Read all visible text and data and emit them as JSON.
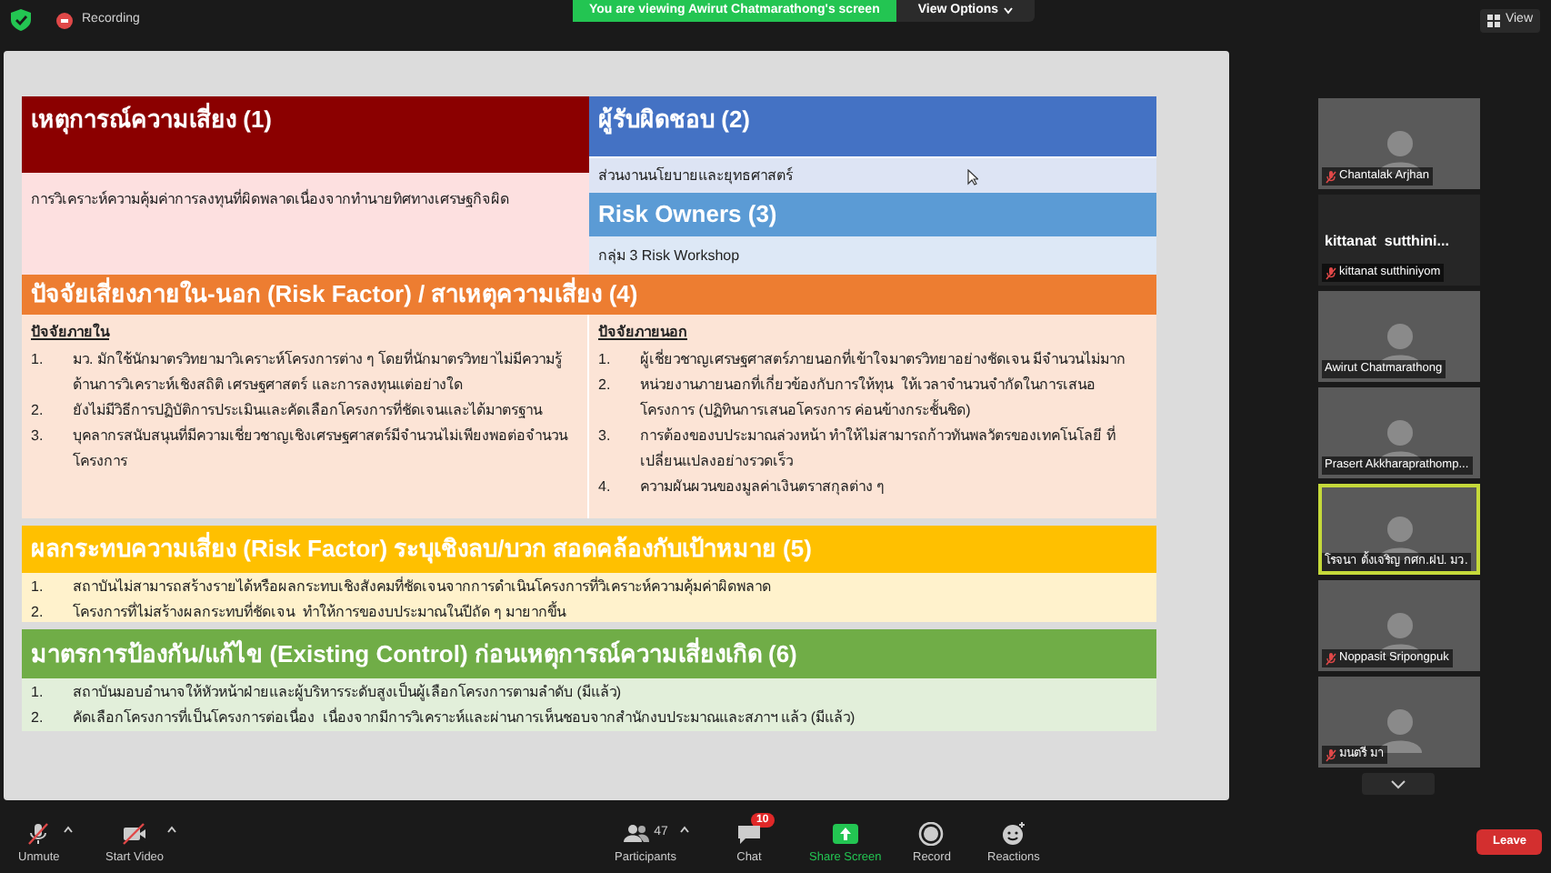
{
  "top_bar": {
    "recording": "Recording",
    "banner": "You are viewing Awirut Chatmarathong's screen",
    "view_options": "View Options",
    "view": "View"
  },
  "slide": {
    "event": {
      "title": "เหตุการณ์ความเสี่ยง (1)",
      "text": "การวิเคราะห์ความคุ้มค่าการลงทุนที่ผิดพลาดเนื่องจากทำนายทิศทางเศรษฐกิจผิด"
    },
    "owner": {
      "title": "ผู้รับผิดชอบ (2)",
      "text": "ส่วนงานนโยบายและยุทธศาสตร์"
    },
    "risk_owners": {
      "title": "Risk Owners (3)",
      "text": "กลุ่ม 3 Risk Workshop"
    },
    "factors": {
      "title": "ปัจจัยเสี่ยงภายใน-นอก (Risk Factor) / สาเหตุความเสี่ยง (4)",
      "columns": [
        {
          "heading": "ปัจจัยภายใน",
          "items": [
            {
              "number": "1.",
              "text": "มว. มักใช้นักมาตรวิทยามาวิเคราะห์โครงการต่าง ๆ โดยที่นักมาตรวิทยาไม่มีความรู้ด้านการวิเคราะห์เชิงสถิติ เศรษฐศาสตร์ และการลงทุนแต่อย่างใด"
            },
            {
              "number": "2.",
              "text": "ยังไม่มีวิธีการปฏิบัติการประเมินและคัดเลือกโครงการที่ชัดเจนและได้มาตรฐาน"
            },
            {
              "number": "3.",
              "text": "บุคลากรสนับสนุนที่มีความเชี่ยวชาญเชิงเศรษฐศาสตร์มีจำนวนไม่เพียงพอต่อจำนวนโครงการ"
            }
          ]
        },
        {
          "heading": "ปัจจัยภายนอก",
          "items": [
            {
              "number": "1.",
              "text": "ผู้เชี่ยวชาญเศรษฐศาสตร์ภายนอกที่เข้าใจมาตรวิทยาอย่างชัดเจน มีจำนวนไม่มาก"
            },
            {
              "number": "2.",
              "text": "หน่วยงานภายนอกที่เกี่ยวข้องกับการให้ทุน  ให้เวลาจำนวนจำกัดในการเสนอโครงการ (ปฏิทินการเสนอโครงการ ค่อนข้างกระชั้นชิด)"
            },
            {
              "number": "3.",
              "text": "การต้องของบประมาณล่วงหน้า ทำให้ไม่สามารถก้าวทันพลวัตรของเทคโนโลยี ที่เปลี่ยนแปลงอย่างรวดเร็ว"
            },
            {
              "number": "4.",
              "text": "ความผันผวนของมูลค่าเงินตราสกุลต่าง ๆ"
            }
          ]
        }
      ]
    },
    "impact": {
      "title": "ผลกระทบความเสี่ยง (Risk Factor) ระบุเชิงลบ/บวก สอดคล้องกับเป้าหมาย (5)",
      "items": [
        {
          "number": "1.",
          "text": "สถาบันไม่สามารถสร้างรายได้หรือผลกระทบเชิงสังคมที่ชัดเจนจากการดำเนินโครงการที่วิเคราะห์ความคุ้มค่าผิดพลาด"
        },
        {
          "number": "2.",
          "text": "โครงการที่ไม่สร้างผลกระทบที่ชัดเจน  ทำให้การของบประมาณในปีถัด ๆ มายากขึ้น"
        }
      ]
    },
    "controls": {
      "title": "มาตรการป้องกัน/แก้ไข (Existing Control) ก่อนเหตุการณ์ความเสี่ยงเกิด (6)",
      "items": [
        {
          "number": "1.",
          "text": "สถาบันมอบอำนาจให้หัวหน้าฝ่ายและผู้บริหารระดับสูงเป็นผู้เลือกโครงการตามลำดับ (มีแล้ว)"
        },
        {
          "number": "2.",
          "text": "คัดเลือกโครงการที่เป็นโครงการต่อเนื่อง  เนื่องจากมีการวิเคราะห์และผ่านการเห็นชอบจากสำนักงบประมาณและสภาฯ แล้ว (มีแล้ว)"
        }
      ]
    }
  },
  "participants": [
    {
      "kind": "video",
      "name": "Chantalak Arjhan",
      "muted": true,
      "speaking": false
    },
    {
      "kind": "name_only",
      "display_name": "kittanat  sutthini...",
      "name": "kittanat sutthiniyom",
      "muted": true,
      "speaking": false
    },
    {
      "kind": "video",
      "name": "Awirut Chatmarathong",
      "muted": false,
      "speaking": false
    },
    {
      "kind": "video",
      "name": "Prasert Akkharaprathomp...",
      "muted": false,
      "speaking": false
    },
    {
      "kind": "video",
      "name": "โรจนา ตั้งเจริญ กศก.ฝป. มว.",
      "muted": false,
      "speaking": true
    },
    {
      "kind": "video",
      "name": "Noppasit Sripongpuk",
      "muted": true,
      "speaking": false
    },
    {
      "kind": "video",
      "name": "มนตรี มา",
      "muted": true,
      "speaking": false
    }
  ],
  "toolbar": [
    {
      "kind": "mic",
      "label": "Unmute",
      "caret": true
    },
    {
      "kind": "video",
      "label": "Start Video",
      "caret": true
    },
    {
      "kind": "participants",
      "label": "Participants",
      "count": "47",
      "caret": true
    },
    {
      "kind": "chat",
      "label": "Chat",
      "badge": "10",
      "caret": false
    },
    {
      "kind": "share",
      "label": "Share Screen",
      "caret": false
    },
    {
      "kind": "record",
      "label": "Record",
      "caret": false
    },
    {
      "kind": "reactions",
      "label": "Reactions",
      "caret": false
    }
  ],
  "leave": "Leave"
}
